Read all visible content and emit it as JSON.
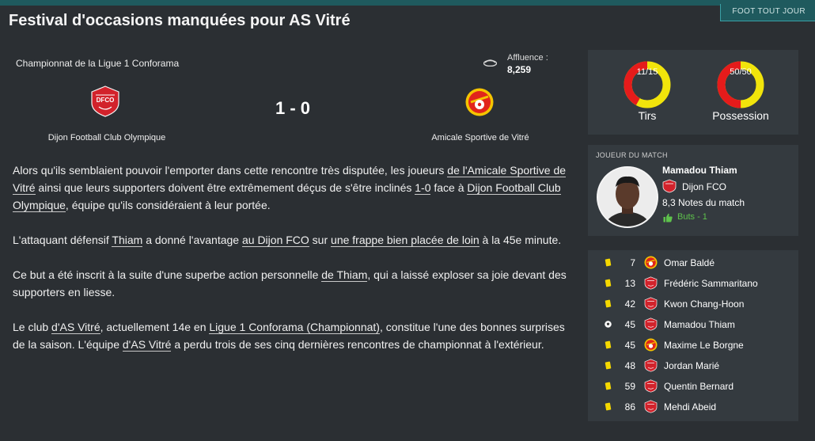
{
  "header": {
    "source_label": "FOOT TOUT JOUR",
    "headline": "Festival d'occasions manquées pour AS Vitré"
  },
  "match": {
    "competition": "Championnat de la Ligue 1 Conforama",
    "attendance_label": "Affluence :",
    "attendance_value": "8,259",
    "score": "1 - 0",
    "home_team": "Dijon Football Club Olympique",
    "away_team": "Amicale Sportive de Vitré",
    "home_badge_text": "DFCO",
    "home_color": "#d2222b",
    "away_color": "#e1251b",
    "away_accent": "#f5c400"
  },
  "article": {
    "p1": {
      "t1": "Alors qu'ils semblaient pouvoir l'emporter dans cette rencontre très disputée, les joueurs ",
      "l1": "de l'Amicale Sportive de Vitré",
      "t2": " ainsi que leurs supporters doivent être extrêmement déçus de s'être inclinés ",
      "l2": "1-0",
      "t3": " face à ",
      "l3": "Dijon Football Club Olympique",
      "t4": ", équipe qu'ils considéraient à leur portée."
    },
    "p2": {
      "t1": "L'attaquant défensif ",
      "l1": "Thiam",
      "t2": " a donné l'avantage ",
      "l2": "au Dijon FCO",
      "t3": " sur ",
      "l3": "une frappe bien placée de loin",
      "t4": " à la 45e minute."
    },
    "p3": {
      "t1": "Ce but a été inscrit à la suite d'une superbe action personnelle ",
      "l1": "de Thiam",
      "t2": ", qui a laissé exploser sa joie devant des supporters en liesse."
    },
    "p4": {
      "t1": "Le club ",
      "l1": "d'AS Vitré",
      "t2": ", actuellement 14e en ",
      "l2": "Ligue 1 Conforama (Championnat)",
      "t3": ", constitue l'une des bonnes surprises de la saison. L'équipe ",
      "l3": "d'AS Vitré",
      "t4": " a perdu trois de ses cinq dernières rencontres de championnat à l'extérieur."
    }
  },
  "stats": {
    "shots": {
      "value": "11/15",
      "label": "Tirs",
      "home_fraction": 0.42
    },
    "possession": {
      "value": "50/50",
      "label": "Possession",
      "home_fraction": 0.5
    },
    "home_color": "#e51b1b",
    "away_color": "#f1e40b"
  },
  "motm": {
    "title": "JOUEUR DU MATCH",
    "name": "Mamadou Thiam",
    "club": "Dijon FCO",
    "rating": "8,3 Notes du match",
    "goals": "Buts - 1",
    "goal_color": "#5ec24c"
  },
  "events": [
    {
      "type": "yellow-card",
      "minute": "7",
      "team": "away",
      "player": "Omar Baldé"
    },
    {
      "type": "yellow-card",
      "minute": "13",
      "team": "home",
      "player": "Frédéric Sammaritano"
    },
    {
      "type": "yellow-card",
      "minute": "42",
      "team": "home",
      "player": "Kwon Chang-Hoon"
    },
    {
      "type": "goal",
      "minute": "45",
      "team": "home",
      "player": "Mamadou Thiam"
    },
    {
      "type": "yellow-card",
      "minute": "45",
      "team": "away",
      "player": "Maxime Le Borgne"
    },
    {
      "type": "yellow-card",
      "minute": "48",
      "team": "home",
      "player": "Jordan Marié"
    },
    {
      "type": "yellow-card",
      "minute": "59",
      "team": "home",
      "player": "Quentin Bernard"
    },
    {
      "type": "yellow-card",
      "minute": "86",
      "team": "home",
      "player": "Mehdi Abeid"
    }
  ]
}
